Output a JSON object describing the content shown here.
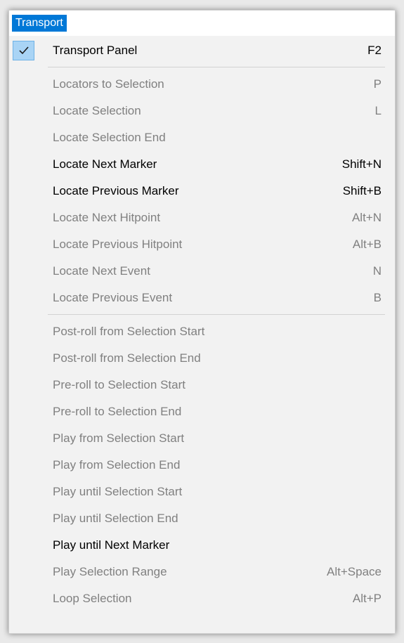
{
  "menu": {
    "title": "Transport",
    "checked_item": {
      "label": "Transport Panel",
      "shortcut": "F2",
      "checked": true,
      "icon": "checkmark-icon"
    },
    "group1": [
      {
        "label": "Locators to Selection",
        "shortcut": "P",
        "enabled": false
      },
      {
        "label": "Locate Selection",
        "shortcut": "L",
        "enabled": false
      },
      {
        "label": "Locate Selection End",
        "shortcut": "",
        "enabled": false
      },
      {
        "label": "Locate Next Marker",
        "shortcut": "Shift+N",
        "enabled": true
      },
      {
        "label": "Locate Previous Marker",
        "shortcut": "Shift+B",
        "enabled": true
      },
      {
        "label": "Locate Next Hitpoint",
        "shortcut": "Alt+N",
        "enabled": false
      },
      {
        "label": "Locate Previous Hitpoint",
        "shortcut": "Alt+B",
        "enabled": false
      },
      {
        "label": "Locate Next Event",
        "shortcut": "N",
        "enabled": false
      },
      {
        "label": "Locate Previous Event",
        "shortcut": "B",
        "enabled": false
      }
    ],
    "group2": [
      {
        "label": "Post-roll from Selection Start",
        "shortcut": "",
        "enabled": false
      },
      {
        "label": "Post-roll from Selection End",
        "shortcut": "",
        "enabled": false
      },
      {
        "label": "Pre-roll to Selection Start",
        "shortcut": "",
        "enabled": false
      },
      {
        "label": "Pre-roll to Selection End",
        "shortcut": "",
        "enabled": false
      },
      {
        "label": "Play from Selection Start",
        "shortcut": "",
        "enabled": false
      },
      {
        "label": "Play from Selection End",
        "shortcut": "",
        "enabled": false
      },
      {
        "label": "Play until Selection Start",
        "shortcut": "",
        "enabled": false
      },
      {
        "label": "Play until Selection End",
        "shortcut": "",
        "enabled": false
      },
      {
        "label": "Play until Next Marker",
        "shortcut": "",
        "enabled": true
      },
      {
        "label": "Play Selection Range",
        "shortcut": "Alt+Space",
        "enabled": false
      },
      {
        "label": "Loop Selection",
        "shortcut": "Alt+P",
        "enabled": false
      }
    ]
  },
  "colors": {
    "menu_title_bg": "#0078d7",
    "enabled_text": "#000000",
    "disabled_text": "#808080",
    "check_highlight": "#a9d4f5"
  }
}
